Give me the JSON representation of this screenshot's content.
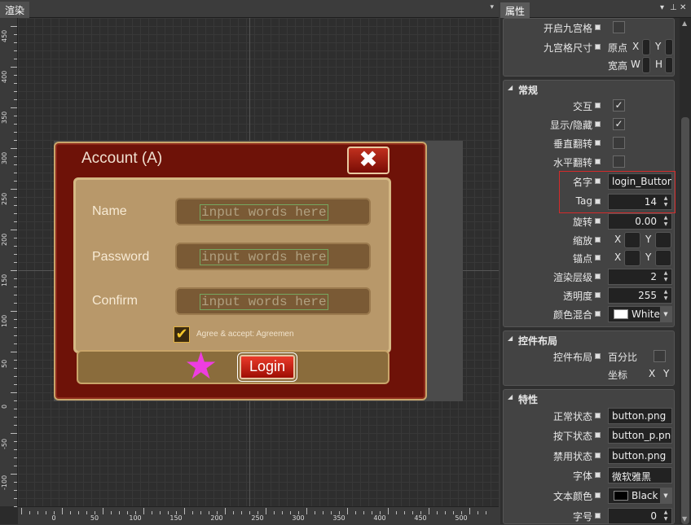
{
  "render_panel": {
    "tab_label": "渲染",
    "pin": "▾",
    "v_ruler_labels": [
      "450",
      "400",
      "350",
      "300",
      "250",
      "200",
      "150",
      "100",
      "50",
      "0",
      "-50",
      "-100"
    ],
    "h_ruler_labels": [
      "0",
      "50",
      "100",
      "150",
      "200",
      "250",
      "300",
      "350",
      "400",
      "450",
      "500"
    ]
  },
  "dialog": {
    "title": "Account (A)",
    "close_glyph": "✖",
    "fields": [
      {
        "label": "Name",
        "placeholder": "input words here"
      },
      {
        "label": "Password",
        "placeholder": "input words here"
      },
      {
        "label": "Confirm",
        "placeholder": "input words here"
      }
    ],
    "agree_check": "✔",
    "agree_text": "Agree & accept: Agreemen",
    "star_glyph": "★",
    "login_label": "Login"
  },
  "props_panel": {
    "tab_label": "属性",
    "header_controls": [
      "▾",
      "⊥",
      "✕"
    ],
    "top": {
      "nine_grid_label": "开启九宫格",
      "nine_grid_size_label": "九宫格尺寸",
      "origin_label": "原点",
      "size_label": "宽高",
      "x": "X",
      "y": "Y",
      "w": "W",
      "h": "H"
    },
    "general": {
      "header": "常规",
      "interact_label": "交互",
      "interact": "✓",
      "visible_label": "显示/隐藏",
      "visible": "✓",
      "flip_v_label": "垂直翻转",
      "flip_h_label": "水平翻转",
      "name_label": "名字",
      "name_value": "login_Button",
      "tag_label": "Tag",
      "tag_value": "14",
      "rotation_label": "旋转",
      "rotation_value": "0.00",
      "scale_label": "缩放",
      "anchor_label": "锚点",
      "zorder_label": "渲染层级",
      "zorder_value": "2",
      "opacity_label": "透明度",
      "opacity_value": "255",
      "blend_label": "颜色混合",
      "blend_value": "White",
      "blend_color": "#ffffff",
      "x": "X",
      "y": "Y"
    },
    "layout": {
      "header": "控件布局",
      "layout_label": "控件布局",
      "percent_label": "百分比",
      "coord_label": "坐标",
      "x": "X",
      "y": "Y"
    },
    "features": {
      "header": "特性",
      "normal_label": "正常状态",
      "normal_value": "button.png",
      "pressed_label": "按下状态",
      "pressed_value": "button_p.png",
      "disabled_label": "禁用状态",
      "disabled_value": "button.png",
      "font_label": "字体",
      "font_value": "微软雅黑",
      "text_color_label": "文本颜色",
      "text_color_value": "Black",
      "text_color": "#000000",
      "font_size_label": "字号",
      "font_size_value": "0"
    }
  }
}
